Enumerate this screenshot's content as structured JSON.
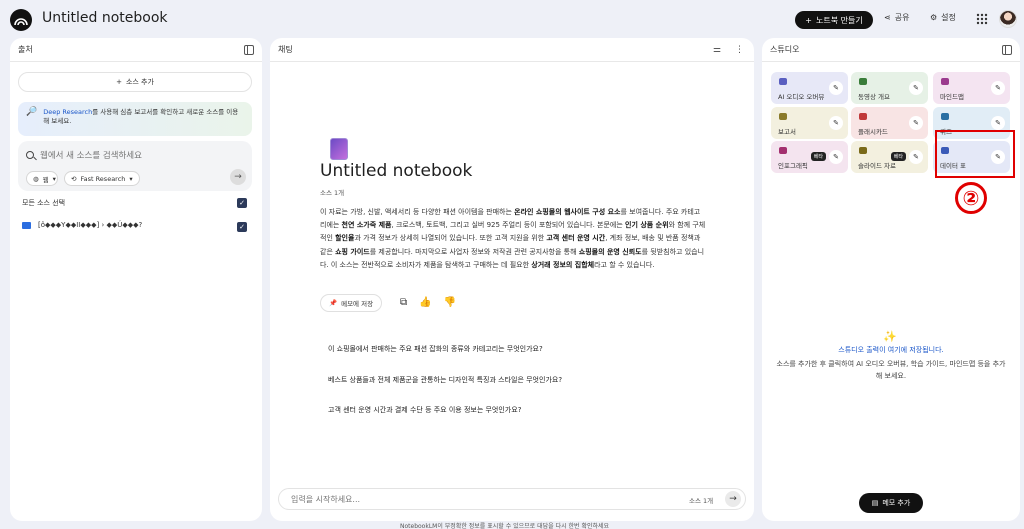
{
  "header": {
    "title": "Untitled notebook",
    "new_notebook": "노트북 만들기",
    "share": "공유",
    "settings": "설정"
  },
  "sources": {
    "panel_title": "출처",
    "add_source": "소스 추가",
    "deep_research_link": "Deep Research",
    "deep_research_text": "를 사용해 심층 보고서를 확인하고 새로운 소스를 이용해 보세요.",
    "search_placeholder": "웹에서 새 소스를 검색하세요",
    "search_mode_web": "웹",
    "search_mode_fast": "Fast Research",
    "select_all": "모든 소스 선택",
    "items": [
      {
        "label": "[ô◆◆◆Y◆◆II◆◆◆] › ◆◆Ú◆◆◆?"
      }
    ]
  },
  "chat": {
    "panel_title": "채팅",
    "notebook_title": "Untitled notebook",
    "source_count": "소스 1개",
    "summary_parts": [
      {
        "text": "이 자료는 가방, 신발, 액세서리 등 다양한 패션 아이템을 판매하는 ",
        "bold": false
      },
      {
        "text": "온라인 쇼핑몰의 웹사이트 구성 요소",
        "bold": true
      },
      {
        "text": "를 보여줍니다. 주요 카테고리에는 ",
        "bold": false
      },
      {
        "text": "천연 소가죽 제품",
        "bold": true
      },
      {
        "text": ", 크로스백, 토트백, 그리고 실버 925 주얼리 등이 포함되어 있습니다. 본문에는 ",
        "bold": false
      },
      {
        "text": "인기 상품 순위",
        "bold": true
      },
      {
        "text": "와 함께 구체적인 ",
        "bold": false
      },
      {
        "text": "할인율",
        "bold": true
      },
      {
        "text": "과 가격 정보가 상세히 나열되어 있습니다. 또한 고객 지원을 위한 ",
        "bold": false
      },
      {
        "text": "고객 센터 운영 시간",
        "bold": true
      },
      {
        "text": ", 계좌 정보, 배송 및 반품 정책과 같은 ",
        "bold": false
      },
      {
        "text": "쇼핑 가이드",
        "bold": true
      },
      {
        "text": "를 제공합니다. 마지막으로 사업자 정보와 저작권 관련 공지사항을 통해 ",
        "bold": false
      },
      {
        "text": "쇼핑몰의 운영 신뢰도",
        "bold": true
      },
      {
        "text": "를 뒷받침하고 있습니다. 이 소스는 전반적으로 소비자가 제품을 탐색하고 구매하는 데 필요한 ",
        "bold": false
      },
      {
        "text": "상거래 정보의 집합체",
        "bold": true
      },
      {
        "text": "라고 할 수 있습니다.",
        "bold": false
      }
    ],
    "save_note": "메모에 저장",
    "questions": [
      "이 쇼핑몰에서 판매하는 주요 패션 잡화의 종류와 카테고리는 무엇인가요?",
      "베스트 상품들과 전체 제품군을 관통하는 디자인적 특징과 스타일은 무엇인가요?",
      "고객 센터 운영 시간과 결제 수단 등 주요 이용 정보는 무엇인가요?"
    ],
    "input_placeholder": "입력을 시작하세요...",
    "input_source_count": "소스 1개",
    "footer": "NotebookLM이 부정확한 정보를 표시할 수 있으므로 대답을 다시 한번 확인하세요"
  },
  "studio": {
    "panel_title": "스튜디오",
    "tiles": [
      {
        "label": "AI 오디오 오버뷰",
        "bg": "#e7e8f7",
        "icon": "#5a5fc0",
        "beta": ""
      },
      {
        "label": "동영상 개요",
        "bg": "#e6f1e6",
        "icon": "#3a7d3a",
        "beta": ""
      },
      {
        "label": "마인드맵",
        "bg": "#f4e4f1",
        "icon": "#9b3a8e",
        "beta": ""
      },
      {
        "label": "보고서",
        "bg": "#f3f0df",
        "icon": "#8a7a2a",
        "beta": ""
      },
      {
        "label": "플래시카드",
        "bg": "#f8e4e4",
        "icon": "#c0393a",
        "beta": ""
      },
      {
        "label": "퀴즈",
        "bg": "#e1edf6",
        "icon": "#2a6fa3",
        "beta": ""
      },
      {
        "label": "인포그래픽",
        "bg": "#f4e4ef",
        "icon": "#a3306f",
        "beta": "베타"
      },
      {
        "label": "슬라이드 자료",
        "bg": "#f3f0df",
        "icon": "#7a6a1a",
        "beta": "베타"
      },
      {
        "label": "데이터 표",
        "bg": "#e4e8f7",
        "icon": "#3a5ab8",
        "beta": ""
      }
    ],
    "empty_title": "스튜디오 출력이 여기에 저장됩니다.",
    "empty_desc": "소스를 추가한 후 클릭하여 AI 오디오 오버뷰, 학습 가이드, 마인드맵 등을 추가해 보세요.",
    "memo_button": "메모 추가"
  },
  "annotation": {
    "number": "②",
    "color": "#e00000"
  }
}
